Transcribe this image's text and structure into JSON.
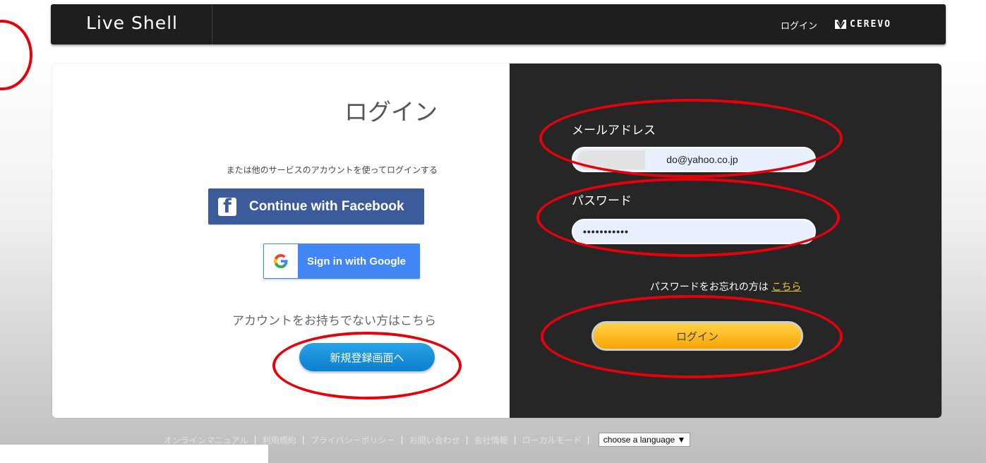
{
  "header": {
    "brand": "Live Shell",
    "login_link": "ログイン",
    "company_logo": "CEREVO"
  },
  "left_panel": {
    "title": "ログイン",
    "other_service_text": "または他のサービスのアカウントを使ってログインする",
    "facebook_button": "Continue with Facebook",
    "google_button": "Sign in with Google",
    "no_account_text": "アカウントをお持ちでない方はこちら",
    "register_button": "新規登録画面へ"
  },
  "right_panel": {
    "email_label": "メールアドレス",
    "email_value": "do@yahoo.co.jp",
    "password_label": "パスワード",
    "password_value": "•••••••••••",
    "forgot_text": "パスワードをお忘れの方は ",
    "forgot_link": "こちら",
    "login_button": "ログイン"
  },
  "footer": {
    "links": [
      "オンラインマニュアル",
      "利用規約",
      "プライバシーポリシー",
      "お問い合わせ",
      "会社情報",
      "ローカルモード"
    ],
    "language_select": "choose a language ▼"
  },
  "colors": {
    "facebook": "#3c5b9a",
    "google": "#4285f4",
    "register": "#1a8fdc",
    "login": "#fbb51c",
    "annotation": "#e8000b",
    "dark_panel": "#262626"
  },
  "icons": [
    "facebook-icon",
    "google-icon",
    "cerevo-logo-icon"
  ]
}
